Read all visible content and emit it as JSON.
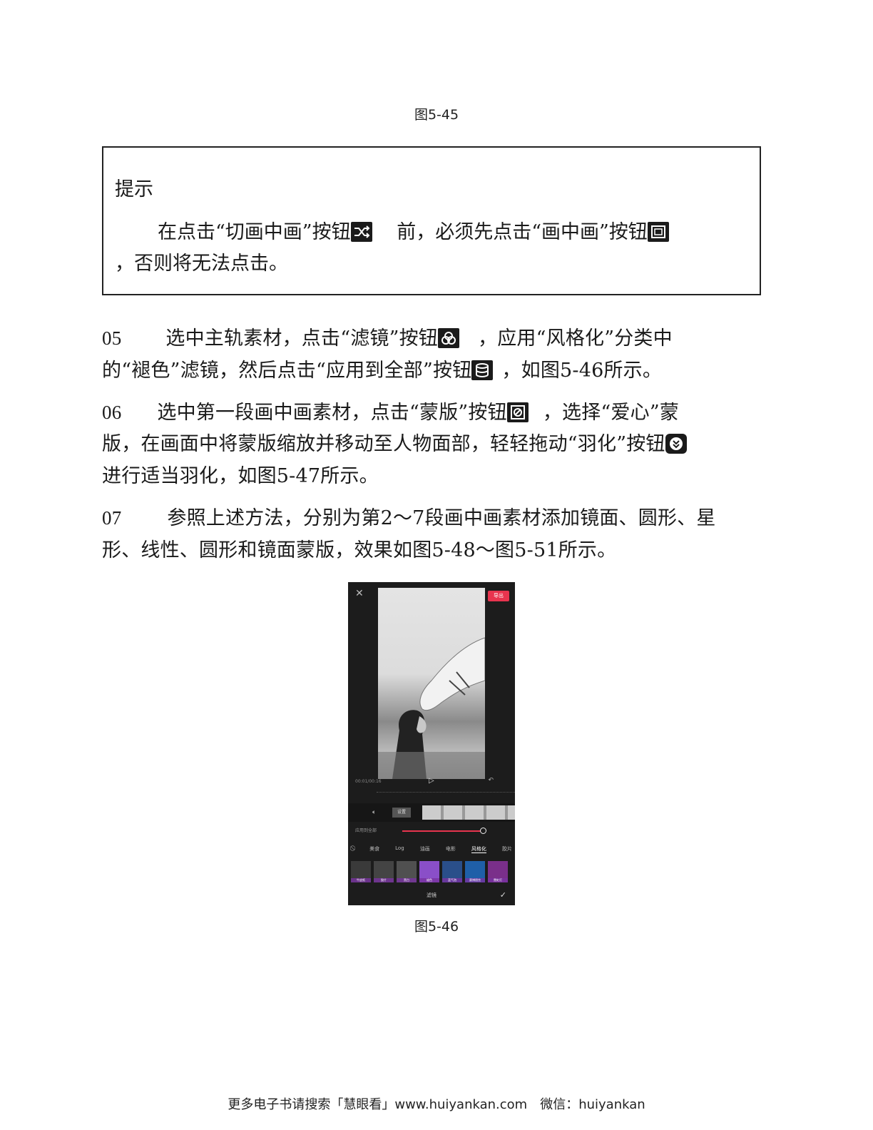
{
  "captions": {
    "fig_top": "图5-45",
    "fig_bottom": "图5-46"
  },
  "tip": {
    "title": "提示",
    "line1_a": "在点击“切画中画”按钮",
    "line1_b": "前，必须先点击“画中画”按钮",
    "line2": "，否则将无法点击。"
  },
  "steps": [
    {
      "number": "05",
      "line1_a": "选中主轨素材，点击“滤镜”按钮",
      "line1_b": "，应用“风格化”分类中",
      "line2_a": "的“褪色”滤镜，然后点击“应用到全部”按钮",
      "line2_b": "，如图5-46所示。"
    },
    {
      "number": "06",
      "line1_a": "选中第一段画中画素材，点击“蒙版”按钮",
      "line1_b": "，选择“爱心”蒙",
      "line2_a": "版，在画面中将蒙版缩放并移动至人物面部，轻轻拖动“羽化”按钮",
      "line3": "进行适当羽化，如图5-47所示。"
    },
    {
      "number": "07",
      "line1": "参照上述方法，分别为第2～7段画中画素材添加镜面、圆形、星",
      "line2": "形、线性、圆形和镜面蒙版，效果如图5-48～图5-51所示。"
    }
  ],
  "phone": {
    "export_label": "导出",
    "cover_label": "设置",
    "apply_all_label": "应用到全部",
    "categories": [
      "美食",
      "Log",
      "油画",
      "电影",
      "风格化",
      "胶片"
    ],
    "thumbs": [
      "牛皮纸",
      "胶片",
      "黑白",
      "褪色",
      "蓝气泡",
      "赛博朋克",
      "霓虹灯"
    ],
    "bottom_label": "滤镜"
  },
  "footer": "更多电子书请搜索「慧眼看」www.huiyankan.com　微信：huiyankan",
  "colors": {
    "accent": "#e8344e",
    "ink": "#1a1a1a",
    "phone_bg": "#1c1c1c"
  }
}
